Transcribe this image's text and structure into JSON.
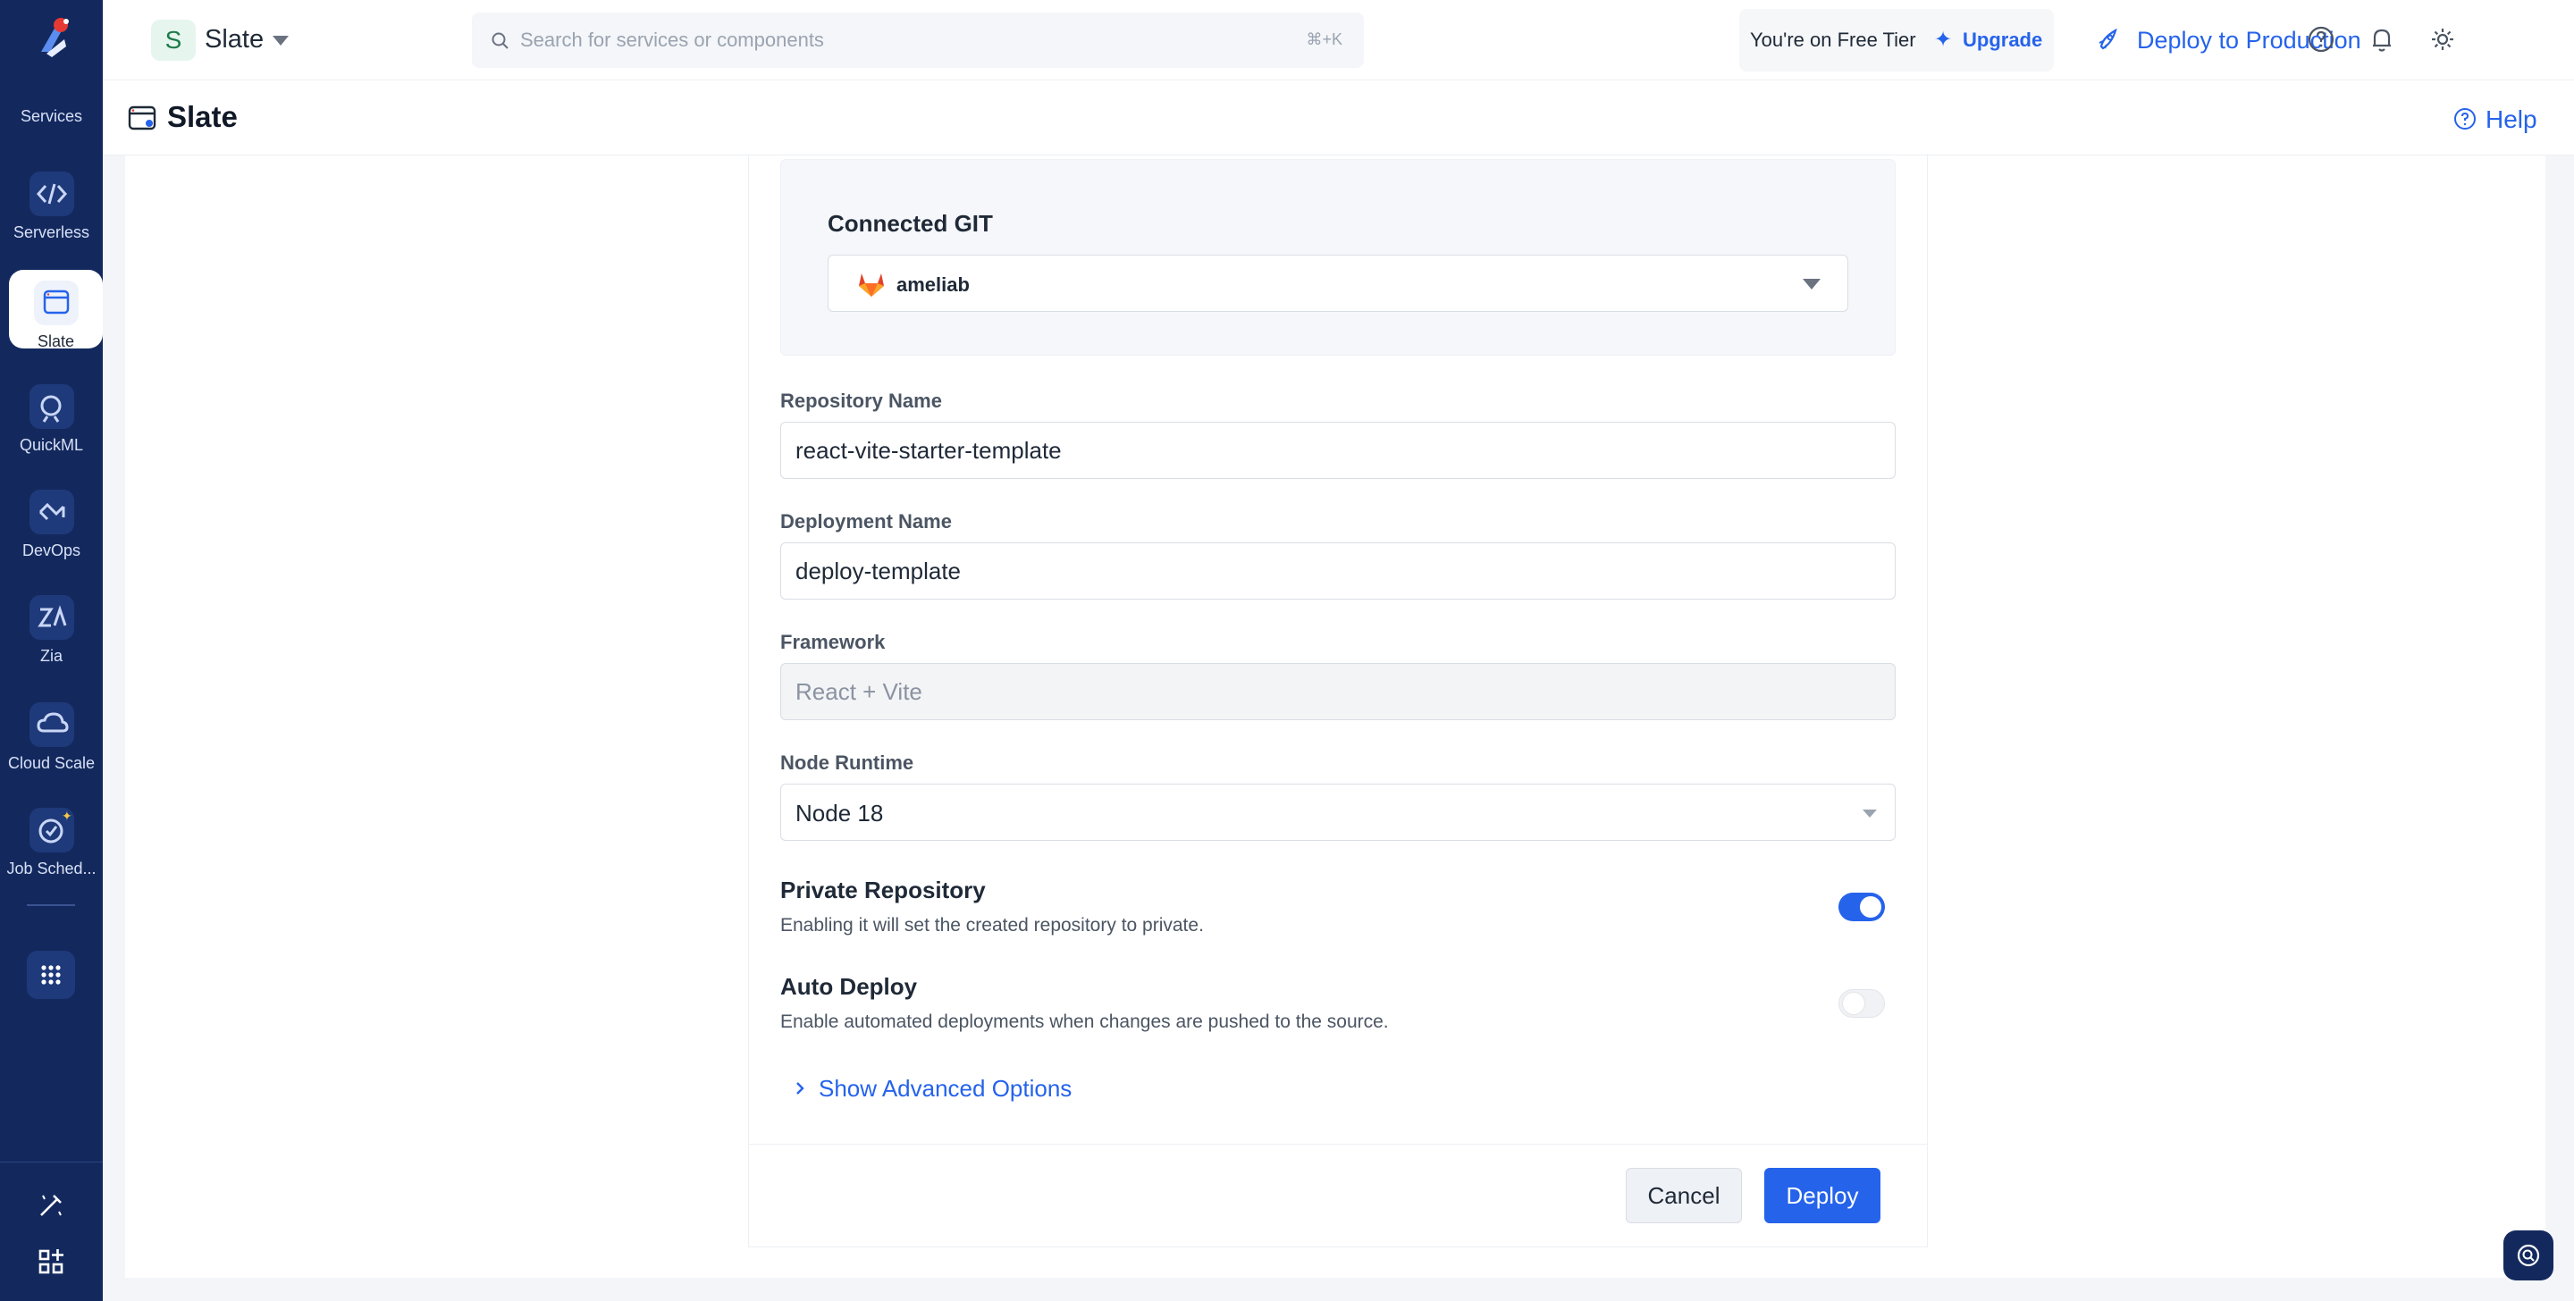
{
  "rail": {
    "items": [
      {
        "label": "Services",
        "icon": "services-icon"
      },
      {
        "label": "Serverless",
        "icon": "serverless-icon"
      },
      {
        "label": "Slate",
        "icon": "slate-icon"
      },
      {
        "label": "QuickML",
        "icon": "quickml-icon"
      },
      {
        "label": "DevOps",
        "icon": "devops-icon"
      },
      {
        "label": "Zia",
        "icon": "zia-icon"
      },
      {
        "label": "Cloud Scale",
        "icon": "cloud-scale-icon"
      },
      {
        "label": "Job Sched...",
        "icon": "job-scheduler-icon"
      }
    ]
  },
  "topbar": {
    "project_initial": "S",
    "project_name": "Slate",
    "search_placeholder": "Search for services or components",
    "search_shortcut": "⌘+K",
    "tier_text": "You're on Free Tier",
    "upgrade_label": "Upgrade",
    "deploy_production_label": "Deploy to Production"
  },
  "subheader": {
    "title": "Slate",
    "help_label": "Help"
  },
  "form": {
    "connected_git_label": "Connected GIT",
    "git_account": "ameliab",
    "repo_name_label": "Repository Name",
    "repo_name_value": "react-vite-starter-template",
    "deployment_name_label": "Deployment Name",
    "deployment_name_value": "deploy-template",
    "framework_label": "Framework",
    "framework_value": "React + Vite",
    "node_runtime_label": "Node Runtime",
    "node_runtime_value": "Node 18",
    "private_repo_title": "Private Repository",
    "private_repo_desc": "Enabling it will set the created repository to private.",
    "private_repo_enabled": true,
    "auto_deploy_title": "Auto Deploy",
    "auto_deploy_desc": "Enable automated deployments when changes are pushed to the source.",
    "auto_deploy_enabled": false,
    "advanced_label": "Show Advanced Options",
    "cancel_label": "Cancel",
    "deploy_label": "Deploy"
  },
  "colors": {
    "rail_bg": "#13295e",
    "accent": "#2563eb"
  }
}
